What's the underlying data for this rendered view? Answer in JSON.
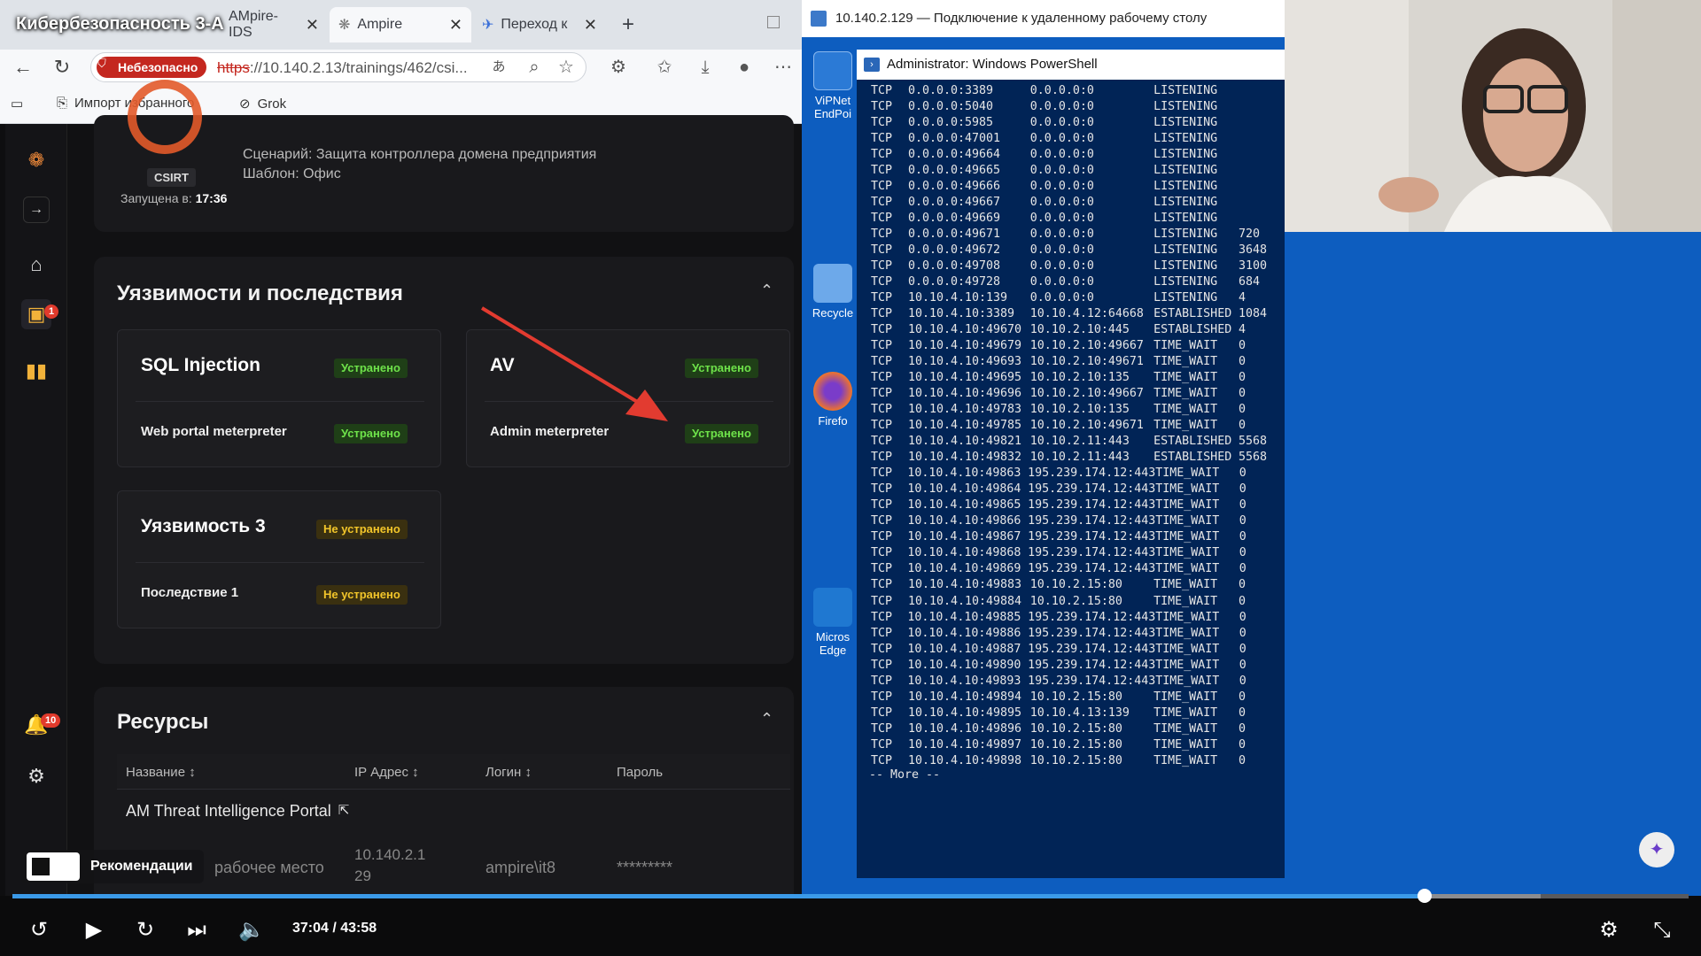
{
  "video": {
    "title": "Кибербезопасность 3-А",
    "time": "37:04 / 43:58",
    "progress": 0.8427,
    "recommendations": "Рекомендации"
  },
  "browser": {
    "tabs": [
      {
        "label": "AMpire-IDS"
      },
      {
        "label": "Ampire"
      },
      {
        "label": "Переход к"
      }
    ],
    "security_label": "Небезопасно",
    "url_scheme": "https",
    "url_rest": "://10.140.2.13/trainings/462/csi...",
    "bookmarks": [
      {
        "label": "Импорт избранного"
      },
      {
        "label": "Grok"
      }
    ]
  },
  "app": {
    "rail_badges": {
      "training": "1",
      "notifications": "10"
    },
    "header": {
      "role": "CSIRT",
      "started_label": "Запущена в:",
      "started_time": "17:36",
      "scenario": "Сценарий: Защита контроллера домена предприятия",
      "template": "Шаблон: Офис"
    },
    "vuln_section": {
      "title": "Уязвимости и последствия",
      "cards": [
        {
          "title": "SQL Injection",
          "status": "Устранено",
          "item": "Web portal meterpreter",
          "item_status": "Устранено"
        },
        {
          "title": "AV",
          "status": "Устранено",
          "item": "Admin meterpreter",
          "item_status": "Устранено"
        },
        {
          "title": "Уязвимость 3",
          "status": "Не устранено",
          "item": "Последствие 1",
          "item_status": "Не устранено"
        }
      ]
    },
    "resources": {
      "title": "Ресурсы",
      "columns": [
        "Название ↕",
        "IP Адрес ↕",
        "Логин ↕",
        "Пароль"
      ],
      "rows": [
        {
          "name": "AM Threat Intelligence Portal"
        },
        {
          "name": "рабочее место",
          "ip_line1": "10.140.2.1",
          "ip_line2": "29",
          "login": "ampire\\it8",
          "password": "*********"
        }
      ]
    }
  },
  "rdp": {
    "title": "10.140.2.129 — Подключение к удаленному рабочему столу",
    "desktop_icons": [
      "ViPNet EndPoi",
      "Recycle",
      "Firefo",
      "Micros Edge"
    ],
    "ps_title": "Administrator: Windows PowerShell",
    "more": "-- More  --",
    "netstat": [
      [
        "TCP",
        "0.0.0.0:3389",
        "0.0.0.0:0",
        "LISTENING",
        ""
      ],
      [
        "TCP",
        "0.0.0.0:5040",
        "0.0.0.0:0",
        "LISTENING",
        ""
      ],
      [
        "TCP",
        "0.0.0.0:5985",
        "0.0.0.0:0",
        "LISTENING",
        ""
      ],
      [
        "TCP",
        "0.0.0.0:47001",
        "0.0.0.0:0",
        "LISTENING",
        ""
      ],
      [
        "TCP",
        "0.0.0.0:49664",
        "0.0.0.0:0",
        "LISTENING",
        ""
      ],
      [
        "TCP",
        "0.0.0.0:49665",
        "0.0.0.0:0",
        "LISTENING",
        ""
      ],
      [
        "TCP",
        "0.0.0.0:49666",
        "0.0.0.0:0",
        "LISTENING",
        ""
      ],
      [
        "TCP",
        "0.0.0.0:49667",
        "0.0.0.0:0",
        "LISTENING",
        ""
      ],
      [
        "TCP",
        "0.0.0.0:49669",
        "0.0.0.0:0",
        "LISTENING",
        ""
      ],
      [
        "TCP",
        "0.0.0.0:49671",
        "0.0.0.0:0",
        "LISTENING",
        "720"
      ],
      [
        "TCP",
        "0.0.0.0:49672",
        "0.0.0.0:0",
        "LISTENING",
        "3648"
      ],
      [
        "TCP",
        "0.0.0.0:49708",
        "0.0.0.0:0",
        "LISTENING",
        "3100"
      ],
      [
        "TCP",
        "0.0.0.0:49728",
        "0.0.0.0:0",
        "LISTENING",
        "684"
      ],
      [
        "TCP",
        "10.10.4.10:139",
        "0.0.0.0:0",
        "LISTENING",
        "4"
      ],
      [
        "TCP",
        "10.10.4.10:3389",
        "10.10.4.12:64668",
        "ESTABLISHED",
        "1084"
      ],
      [
        "TCP",
        "10.10.4.10:49670",
        "10.10.2.10:445",
        "ESTABLISHED",
        "4"
      ],
      [
        "TCP",
        "10.10.4.10:49679",
        "10.10.2.10:49667",
        "TIME_WAIT",
        "0"
      ],
      [
        "TCP",
        "10.10.4.10:49693",
        "10.10.2.10:49671",
        "TIME_WAIT",
        "0"
      ],
      [
        "TCP",
        "10.10.4.10:49695",
        "10.10.2.10:135",
        "TIME_WAIT",
        "0"
      ],
      [
        "TCP",
        "10.10.4.10:49696",
        "10.10.2.10:49667",
        "TIME_WAIT",
        "0"
      ],
      [
        "TCP",
        "10.10.4.10:49783",
        "10.10.2.10:135",
        "TIME_WAIT",
        "0"
      ],
      [
        "TCP",
        "10.10.4.10:49785",
        "10.10.2.10:49671",
        "TIME_WAIT",
        "0"
      ],
      [
        "TCP",
        "10.10.4.10:49821",
        "10.10.2.11:443",
        "ESTABLISHED",
        "5568"
      ],
      [
        "TCP",
        "10.10.4.10:49832",
        "10.10.2.11:443",
        "ESTABLISHED",
        "5568"
      ],
      [
        "TCP",
        "10.10.4.10:49863",
        "195.239.174.12:443",
        "TIME_WAIT",
        "0"
      ],
      [
        "TCP",
        "10.10.4.10:49864",
        "195.239.174.12:443",
        "TIME_WAIT",
        "0"
      ],
      [
        "TCP",
        "10.10.4.10:49865",
        "195.239.174.12:443",
        "TIME_WAIT",
        "0"
      ],
      [
        "TCP",
        "10.10.4.10:49866",
        "195.239.174.12:443",
        "TIME_WAIT",
        "0"
      ],
      [
        "TCP",
        "10.10.4.10:49867",
        "195.239.174.12:443",
        "TIME_WAIT",
        "0"
      ],
      [
        "TCP",
        "10.10.4.10:49868",
        "195.239.174.12:443",
        "TIME_WAIT",
        "0"
      ],
      [
        "TCP",
        "10.10.4.10:49869",
        "195.239.174.12:443",
        "TIME_WAIT",
        "0"
      ],
      [
        "TCP",
        "10.10.4.10:49883",
        "10.10.2.15:80",
        "TIME_WAIT",
        "0"
      ],
      [
        "TCP",
        "10.10.4.10:49884",
        "10.10.2.15:80",
        "TIME_WAIT",
        "0"
      ],
      [
        "TCP",
        "10.10.4.10:49885",
        "195.239.174.12:443",
        "TIME_WAIT",
        "0"
      ],
      [
        "TCP",
        "10.10.4.10:49886",
        "195.239.174.12:443",
        "TIME_WAIT",
        "0"
      ],
      [
        "TCP",
        "10.10.4.10:49887",
        "195.239.174.12:443",
        "TIME_WAIT",
        "0"
      ],
      [
        "TCP",
        "10.10.4.10:49890",
        "195.239.174.12:443",
        "TIME_WAIT",
        "0"
      ],
      [
        "TCP",
        "10.10.4.10:49893",
        "195.239.174.12:443",
        "TIME_WAIT",
        "0"
      ],
      [
        "TCP",
        "10.10.4.10:49894",
        "10.10.2.15:80",
        "TIME_WAIT",
        "0"
      ],
      [
        "TCP",
        "10.10.4.10:49895",
        "10.10.4.13:139",
        "TIME_WAIT",
        "0"
      ],
      [
        "TCP",
        "10.10.4.10:49896",
        "10.10.2.15:80",
        "TIME_WAIT",
        "0"
      ],
      [
        "TCP",
        "10.10.4.10:49897",
        "10.10.2.15:80",
        "TIME_WAIT",
        "0"
      ],
      [
        "TCP",
        "10.10.4.10:49898",
        "10.10.2.15:80",
        "TIME_WAIT",
        "0"
      ]
    ]
  },
  "colors": {
    "ok_green": "#6ee24a",
    "warn_yellow": "#f2c52a",
    "danger_red": "#c4271f",
    "progress_blue": "#3b9ae8",
    "rdp_blue": "#0d5dbf",
    "ps_bg": "#012456"
  }
}
